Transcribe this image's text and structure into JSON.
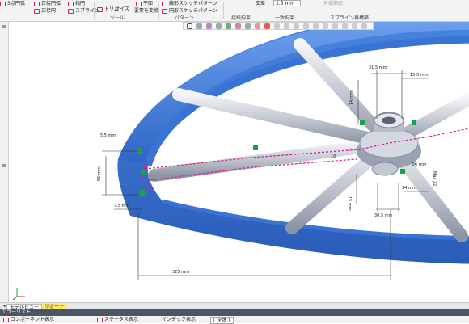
{
  "ribbon": {
    "row1": [
      "3点円弧",
      "正接円弧",
      "楕円",
      "平面",
      "線形スケッチパターン",
      "交差"
    ],
    "row2": [
      "正接円",
      "スプライン",
      "トリム",
      "サイズ",
      "要素を変換",
      "円形スケッチパターン"
    ],
    "value": "2.5 mm",
    "faded": "再構築面",
    "groups": [
      "ツール",
      "パターン",
      "接続拘束",
      "一致拘束",
      "スプライン再構築"
    ]
  },
  "tabs": {
    "model_view": "モデルビュー",
    "support": "サポート"
  },
  "error_list": "エラーリスト",
  "bottom": [
    "コンポーネント表示",
    "ステータス表示",
    "インデック表示",
    "[ 全体 ]"
  ],
  "dims": {
    "d1": "31.5 mm",
    "d2": "15.5 mm",
    "d3": "14 mm",
    "d4": "5.5 mm",
    "d5": "55 mm",
    "d6": "7.5 mm",
    "d7": "325 mm",
    "d8": "30.5 mm",
    "d9": "14 mm",
    "d10": "Max 22",
    "d11": "15 mm",
    "d12": "Φ6 mm",
    "d13": "10"
  },
  "colors": {
    "wheel": "#3f7fdf",
    "spoke": "#c7ccd6",
    "magenta": "#e0188a",
    "green": "#1ca04a"
  }
}
